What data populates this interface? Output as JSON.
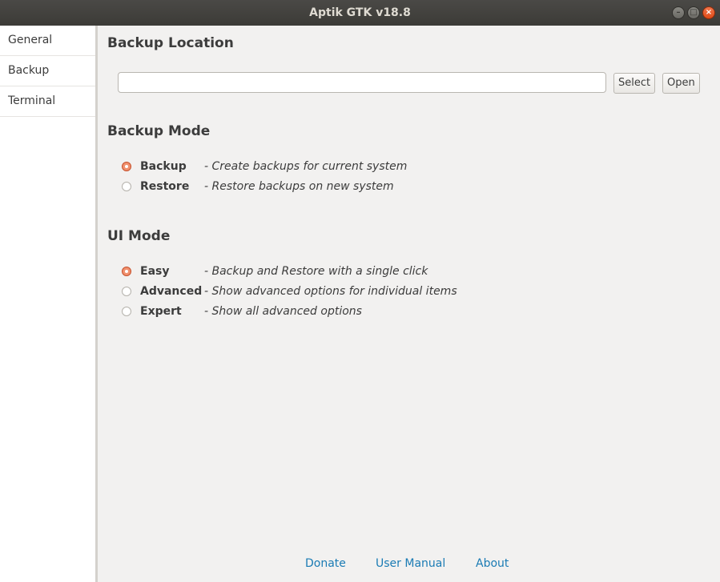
{
  "window": {
    "title": "Aptik GTK v18.8"
  },
  "sidebar": {
    "items": [
      {
        "label": "General"
      },
      {
        "label": "Backup"
      },
      {
        "label": "Terminal"
      }
    ]
  },
  "backup_location": {
    "title": "Backup Location",
    "input_value": "",
    "select_label": "Select",
    "open_label": "Open"
  },
  "backup_mode": {
    "title": "Backup Mode",
    "selected": "Backup",
    "options": [
      {
        "label": "Backup",
        "desc": "- Create backups for current system",
        "checked": true
      },
      {
        "label": "Restore",
        "desc": "- Restore backups on new system",
        "checked": false
      }
    ]
  },
  "ui_mode": {
    "title": "UI Mode",
    "selected": "Easy",
    "options": [
      {
        "label": "Easy",
        "desc": "- Backup and Restore with a single click",
        "checked": true
      },
      {
        "label": "Advanced",
        "desc": "- Show advanced options for individual items",
        "checked": false
      },
      {
        "label": "Expert",
        "desc": "- Show all advanced options",
        "checked": false
      }
    ]
  },
  "footer": {
    "donate": "Donate",
    "user_manual": "User Manual",
    "about": "About"
  },
  "colors": {
    "accent": "#e95420",
    "link": "#1a7bb4",
    "titlebar": "#3c3b37"
  },
  "icons": {
    "minimize": "minimize-icon",
    "maximize": "maximize-icon",
    "close": "close-icon"
  }
}
